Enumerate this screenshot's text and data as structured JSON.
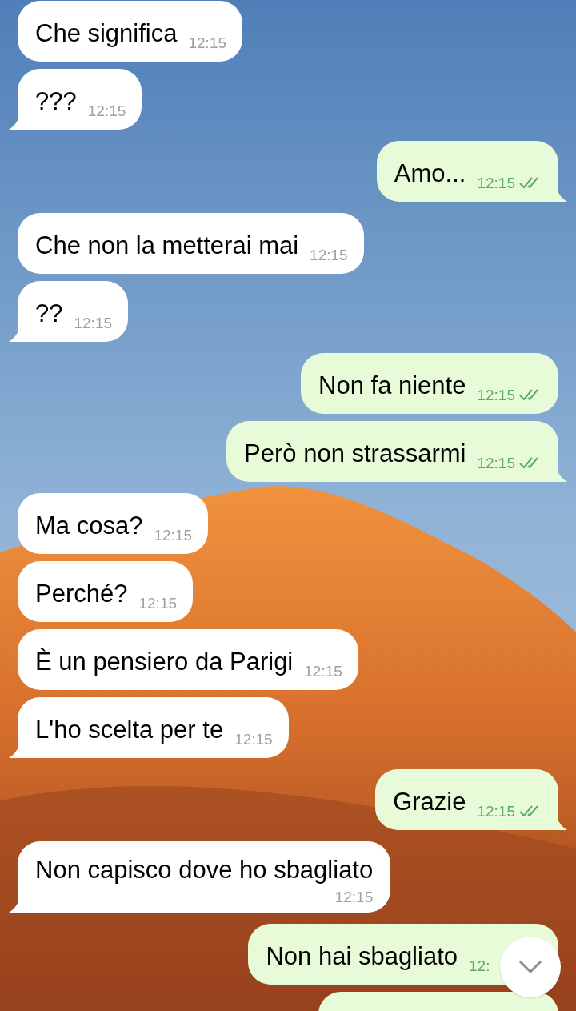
{
  "messages": [
    {
      "text": "Che significa",
      "time": "12:15",
      "outgoing": false,
      "tail": false,
      "read": false
    },
    {
      "text": "???",
      "time": "12:15",
      "outgoing": false,
      "tail": true,
      "read": false
    },
    {
      "text": "Amo...",
      "time": "12:15",
      "outgoing": true,
      "tail": true,
      "read": true
    },
    {
      "text": "Che non la metterai mai",
      "time": "12:15",
      "outgoing": false,
      "tail": false,
      "read": false
    },
    {
      "text": "??",
      "time": "12:15",
      "outgoing": false,
      "tail": true,
      "read": false
    },
    {
      "text": "Non fa niente",
      "time": "12:15",
      "outgoing": true,
      "tail": false,
      "read": true
    },
    {
      "text": "Però non strassarmi",
      "time": "12:15",
      "outgoing": true,
      "tail": true,
      "read": true
    },
    {
      "text": "Ma cosa?",
      "time": "12:15",
      "outgoing": false,
      "tail": false,
      "read": false
    },
    {
      "text": "Perché?",
      "time": "12:15",
      "outgoing": false,
      "tail": false,
      "read": false
    },
    {
      "text": "È un pensiero da Parigi",
      "time": "12:15",
      "outgoing": false,
      "tail": false,
      "read": false
    },
    {
      "text": "L'ho scelta per te",
      "time": "12:15",
      "outgoing": false,
      "tail": true,
      "read": false
    },
    {
      "text": "Grazie",
      "time": "12:15",
      "outgoing": true,
      "tail": true,
      "read": true
    },
    {
      "text": "Non capisco dove ho sbagliato",
      "time": "12:15",
      "outgoing": false,
      "tail": true,
      "read": false,
      "kind": "wrapped"
    },
    {
      "text": "Non hai sbagliato",
      "time": "12:",
      "outgoing": true,
      "tail": false,
      "read": false
    },
    {
      "outgoing": true,
      "kind": "cut"
    }
  ]
}
